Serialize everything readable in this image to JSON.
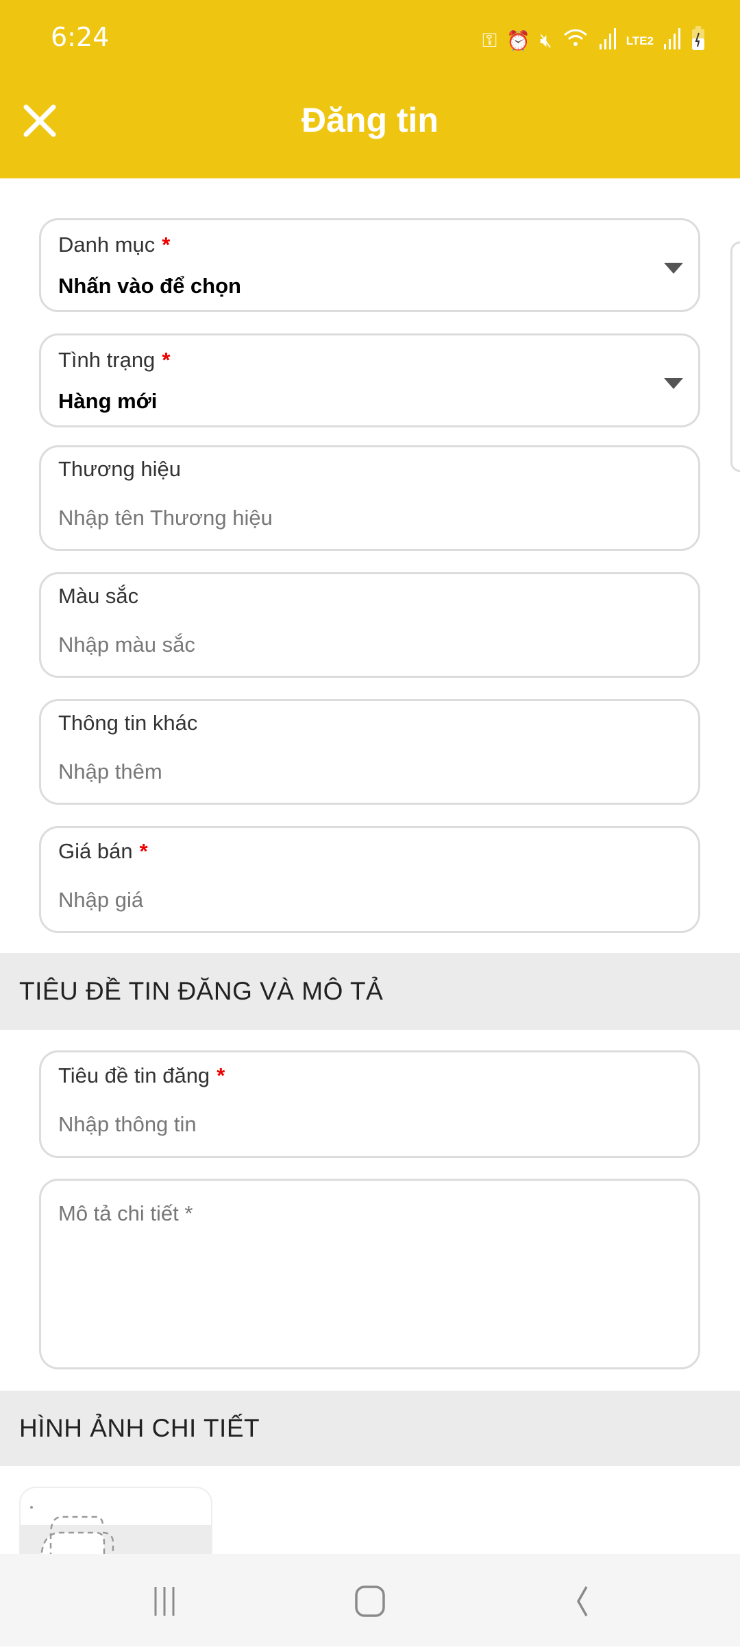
{
  "status_bar": {
    "time": "6:24",
    "icons": [
      "key-icon",
      "alarm-icon",
      "mute-icon",
      "wifi-icon",
      "signal-icon",
      "volte-lte2-icon",
      "signal-icon",
      "battery-charging-icon"
    ],
    "lte_label": "LTE2"
  },
  "header": {
    "title": "Đăng tin",
    "close_icon": "close-icon",
    "background": "#eec511"
  },
  "form": {
    "category": {
      "label": "Danh mục",
      "required": "*",
      "value": "Nhấn vào để chọn"
    },
    "condition": {
      "label": "Tình trạng",
      "required": "*",
      "value": "Hàng mới"
    },
    "brand": {
      "label": "Thương hiệu",
      "placeholder": "Nhập tên Thương hiệu"
    },
    "color": {
      "label": "Màu sắc",
      "placeholder": "Nhập màu sắc"
    },
    "other": {
      "label": "Thông tin khác",
      "placeholder": "Nhập thêm"
    },
    "price": {
      "label": "Giá bán",
      "required": "*",
      "placeholder": "Nhập giá"
    }
  },
  "section_title": {
    "heading": "TIÊU ĐỀ TIN ĐĂNG VÀ MÔ TẢ",
    "title_field": {
      "label": "Tiêu đề tin đăng",
      "required": "*",
      "placeholder": "Nhập thông tin"
    },
    "description": {
      "placeholder": "Mô tả chi tiết *"
    }
  },
  "section_images": {
    "heading": "HÌNH ẢNH CHI TIẾT"
  },
  "nav": {
    "recents": "recents-icon",
    "home": "home-icon",
    "back": "back-icon"
  }
}
